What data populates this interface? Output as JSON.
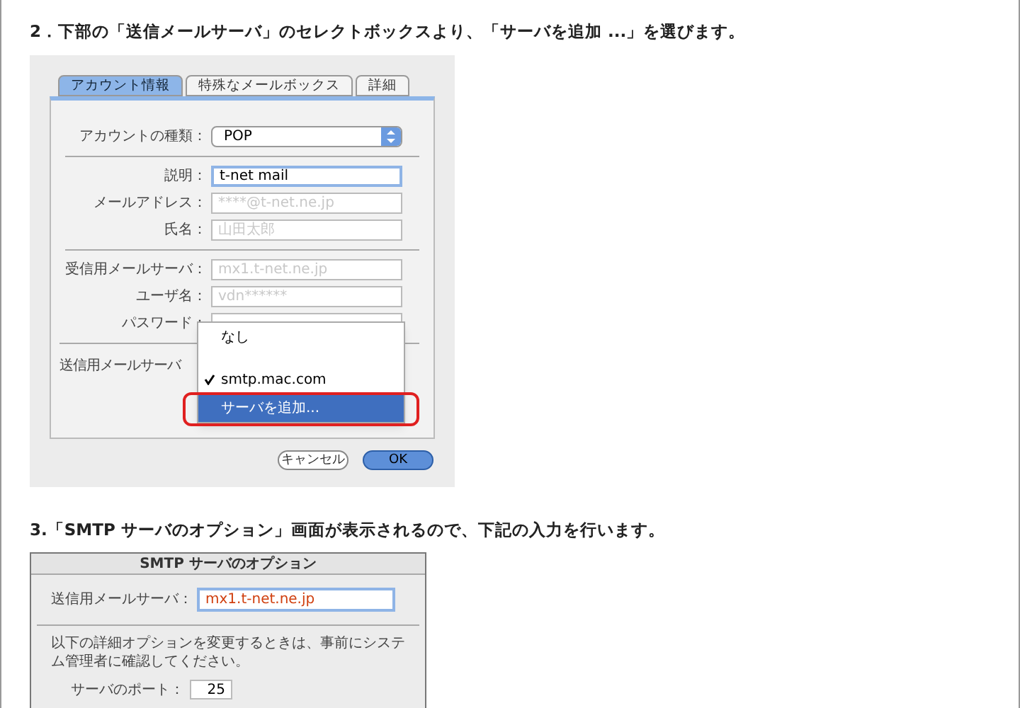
{
  "step1": {
    "heading": "2．下部の「送信メールサーバ」のセレクトボックスより、「サーバを追加 ...」を選びます。",
    "tabs": [
      {
        "label": "アカウント情報",
        "selected": true
      },
      {
        "label": "特殊なメールボックス",
        "selected": false
      },
      {
        "label": "詳細",
        "selected": false
      }
    ],
    "sections": [
      {
        "fields": [
          {
            "kind": "popup",
            "label": "アカウントの種類：",
            "value": "POP",
            "focused": false
          }
        ]
      },
      {
        "fields": [
          {
            "kind": "text",
            "label": "説明：",
            "value": "t-net mail",
            "focused": true
          },
          {
            "kind": "text",
            "label": "メールアドレス：",
            "placeholder": "****@t-net.ne.jp",
            "focused": false
          },
          {
            "kind": "text",
            "label": "氏名：",
            "placeholder": "山田太郎",
            "focused": false
          }
        ]
      },
      {
        "fields": [
          {
            "kind": "text",
            "label": "受信用メールサーバ：",
            "placeholder": "mx1.t-net.ne.jp",
            "focused": false
          },
          {
            "kind": "text",
            "label": "ユーザ名：",
            "placeholder": "vdn******",
            "focused": false
          },
          {
            "kind": "text",
            "label": "パスワード：",
            "focused": false
          }
        ]
      }
    ],
    "outgoing_label": "送信用メールサーバ",
    "menu": [
      {
        "label": "なし",
        "checked": false,
        "selected": false
      },
      {
        "label": "smtp.mac.com",
        "checked": true,
        "selected": false
      },
      {
        "label": "サーバを追加...",
        "checked": false,
        "selected": true
      }
    ],
    "buttons": [
      {
        "label": "キャンセル",
        "default": false
      },
      {
        "label": "OK",
        "default": true
      }
    ]
  },
  "step2": {
    "heading": "3.「SMTP サーバのオプション」画面が表示されるので、下記の入力を行います。",
    "dialog_title": "SMTP サーバのオプション",
    "server_label": "送信用メールサーバ：",
    "server_value": "mx1.t-net.ne.jp",
    "note": "以下の詳細オプションを変更するときは、事前にシステム管理者に確認してください。",
    "port_label": "サーバのポート：",
    "port_value": "25"
  }
}
